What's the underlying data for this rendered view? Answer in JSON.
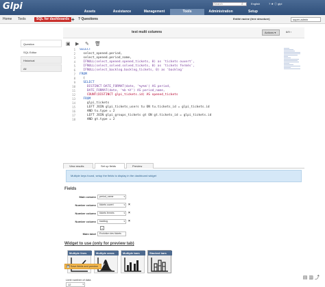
{
  "header": {
    "logo": "Glpi",
    "search_placeholder": "Search",
    "language": "English",
    "user_links": "? ★ ⓘ glpi",
    "menu": [
      "Assets",
      "Assistance",
      "Management",
      "Tools",
      "Administration",
      "Setup"
    ],
    "active_menu": "Tools"
  },
  "breadcrumb": {
    "home": "Home",
    "tools": "Tools",
    "current": "SQL for dashboards",
    "add": "+",
    "questions": "Questions",
    "entity": "Entité racine (tree structure)",
    "profile": "super-admin"
  },
  "sidebar": {
    "items": [
      "Question",
      "SQL Editor",
      "Historical",
      "All"
    ]
  },
  "panel": {
    "title": "test multi columns",
    "actions": "Actions ▾",
    "pager": "6/9"
  },
  "sql_lines": [
    "SELECT",
    "  select_opened.period,",
    "  select_opened.period_name,",
    "  IFNULL(select_opened.opened_tickets, 0) as 'tickets ouvert',",
    "  IFNULL(select_solved.solved_tickets, 0) as 'tickets fermés',",
    "  IFNULL(select_backlog.backlog_tickets, 0) as 'backlog'",
    "FROM",
    "  (",
    "  SELECT",
    "    DISTINCT DATE_FORMAT(date, '%y%m') AS period,",
    "    DATE_FORMAT(date, '%b %Y') AS period_name,",
    "    COUNT(DISTINCT glpi_tickets.id) AS opened_tickets",
    "  FROM",
    "    glpi_tickets",
    "    LEFT JOIN glpi_tickets_users tu ON tu.tickets_id = glpi_tickets.id",
    "    AND tu.type = 2",
    "    LEFT JOIN glpi_groups_tickets gt ON gt.tickets_id = glpi_tickets.id",
    "    AND gt.type = 2"
  ],
  "tabs": [
    "View results",
    "Set up fields",
    "Preview"
  ],
  "active_tab": "Set up fields",
  "info_message": "Multiple keys found, setup the fields to display in the dashboard widget",
  "fields_title": "Fields",
  "fields": [
    {
      "label": "Main column",
      "value": "period_name"
    },
    {
      "label": "Number column",
      "value": "tickets ouvert"
    },
    {
      "label": "Number column",
      "value": "tickets fermés"
    },
    {
      "label": "Number column",
      "value": "backlog"
    }
  ],
  "add_field": "+",
  "main_label_label": "Main label",
  "main_label_value": "Evolution des tickets",
  "widget_title": "Widget to use (only for preview tab)",
  "widgets": [
    "Multiple lines",
    "Multiple areas",
    "Multiple bars",
    "Stacked bars"
  ],
  "active_widget": "Stacked bars",
  "limit_label": "Limit number of data",
  "limit_value": "12",
  "save_button": "Save fields and preview"
}
